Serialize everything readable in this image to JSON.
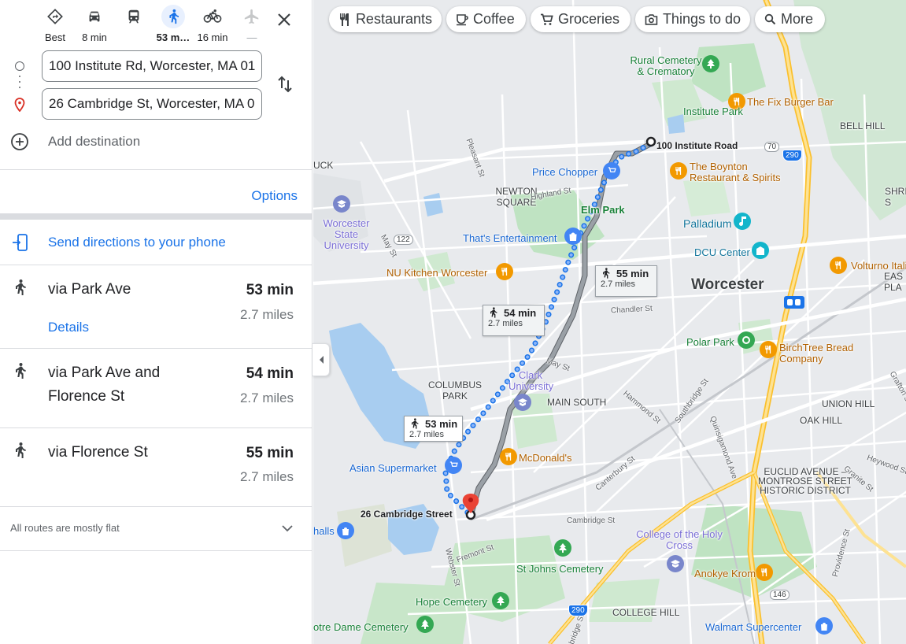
{
  "travel_modes": [
    {
      "id": "best",
      "label": "Best",
      "icon": "diamond-directions-icon",
      "active": false
    },
    {
      "id": "drive",
      "label": "8 min",
      "icon": "car-icon",
      "active": false
    },
    {
      "id": "transit",
      "label": "",
      "icon": "train-icon",
      "active": false
    },
    {
      "id": "walk",
      "label": "53 m…",
      "icon": "walk-icon",
      "active": true
    },
    {
      "id": "bike",
      "label": "16 min",
      "icon": "bike-icon",
      "active": false
    },
    {
      "id": "flight",
      "label": "—",
      "icon": "airplane-icon",
      "active": false
    }
  ],
  "origin": {
    "value": "100 Institute Rd, Worcester, MA 01609"
  },
  "destination": {
    "value": "26 Cambridge St, Worcester, MA 01610"
  },
  "add_destination": "Add destination",
  "options_label": "Options",
  "send_directions": "Send directions to your phone",
  "routes": [
    {
      "name": "via Park Ave",
      "time": "53 min",
      "distance": "2.7 miles",
      "details": "Details"
    },
    {
      "name": "via Park Ave and Florence St",
      "time": "54 min",
      "distance": "2.7 miles"
    },
    {
      "name": "via Florence St",
      "time": "55 min",
      "distance": "2.7 miles"
    }
  ],
  "terrain_note": "All routes are mostly flat",
  "map": {
    "chips": [
      {
        "label": "Restaurants",
        "icon": "fork-knife-icon"
      },
      {
        "label": "Coffee",
        "icon": "coffee-icon"
      },
      {
        "label": "Groceries",
        "icon": "cart-icon"
      },
      {
        "label": "Things to do",
        "icon": "camera-icon"
      },
      {
        "label": "More",
        "icon": "search-icon"
      }
    ],
    "route_labels": [
      {
        "time": "53 min",
        "distance": "2.7 miles"
      },
      {
        "time": "54 min",
        "distance": "2.7 miles"
      },
      {
        "time": "55 min",
        "distance": "2.7 miles"
      }
    ],
    "start_label": "100 Institute Road",
    "end_label": "26 Cambridge Street",
    "places": {
      "rural_cemetery": "Rural Cemetery & Crematory",
      "fix_burger": "The Fix Burger Bar",
      "institute_park": "Institute Park",
      "bell_hill": "BELL HILL",
      "boynton": "The Boynton Restaurant & Spirits",
      "price_chopper": "Price Chopper",
      "newton_square": "NEWTON SQUARE",
      "elm_park": "Elm Park",
      "palladium": "Palladium",
      "wsu": "Worcester State University",
      "thats_ent": "That's Entertainment",
      "dcu": "DCU Center",
      "nu_kitchen": "NU Kitchen Worcester",
      "worcester": "Worcester",
      "italian": "Volturno Italian T",
      "polar_park": "Polar Park",
      "birchtree": "BirchTree Bread Company",
      "clark": "Clark University",
      "columbus_park": "COLUMBUS PARK",
      "main_south": "MAIN SOUTH",
      "union_hill": "UNION HILL",
      "oak_hill": "OAK HILL",
      "mcdonalds": "McDonald's",
      "asian_super": "Asian Supermarket",
      "euclid": "EUCLID AVENUE –MONTROSE STREET HISTORIC DISTRICT",
      "holy_cross": "College of the Holy Cross",
      "anokye": "Anokye Krom",
      "st_johns": "St Johns Cemetery",
      "hope_cemetery": "Hope Cemetery",
      "notre_dame": "Notre Dame Cemetery",
      "college_hill": "COLLEGE HILL",
      "walmart": "Walmart Supercenter",
      "halls": "halls",
      "uck": "UCK",
      "shr": "SHRI"
    },
    "streets": {
      "highland": "Highland St",
      "pleasant": "Pleasant St",
      "may_st_w": "May St",
      "chandler": "Chandler St",
      "may_st": "May St",
      "hammond": "Hammond St",
      "southbridge": "Southbridge St",
      "quinsigamond": "Quinsigamond Ave",
      "canterbury": "Canterbury St",
      "cambridge": "Cambridge St",
      "fremont": "Fremont St",
      "webster": "Webster St",
      "heywood": "Heywood St",
      "granite": "Granite St",
      "providence": "Providence St",
      "grafton": "Grafton St"
    },
    "shields": {
      "r122": "122",
      "r70": "70",
      "i290a": "290",
      "i290b": "290",
      "r146": "146"
    }
  }
}
